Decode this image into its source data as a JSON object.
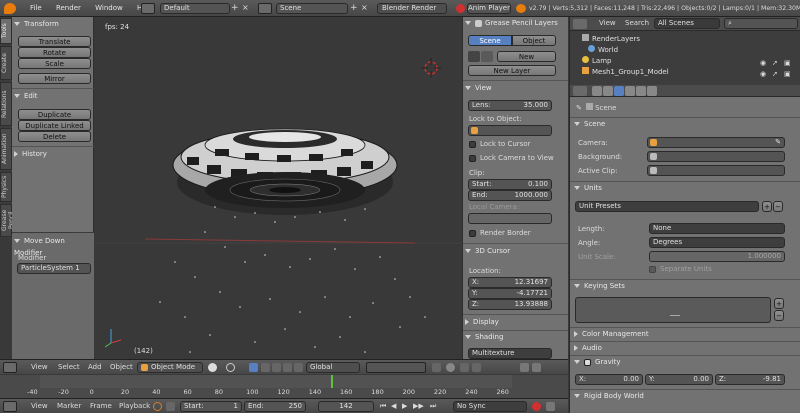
{
  "top_bar": {
    "menus": [
      "File",
      "Render",
      "Window",
      "Help"
    ],
    "screen_layout": "Default",
    "scene_name": "Scene",
    "render_engine": "Blender Render",
    "anim_player": "Anim Player",
    "stats": "v2.79 | Verts:5,312 | Faces:11,248 | Tris:22,496 | Objects:0/2 | Lamps:0/1 | Mem:32.30M"
  },
  "tool_tabs": [
    "Tools",
    "Create",
    "Relations",
    "Animation",
    "Physics",
    "Grease Pencil"
  ],
  "tool_shelf": {
    "transform_title": "Transform",
    "translate": "Translate",
    "rotate": "Rotate",
    "scale": "Scale",
    "mirror": "Mirror",
    "edit_title": "Edit",
    "duplicate": "Duplicate",
    "duplicate_linked": "Duplicate Linked",
    "delete": "Delete",
    "history_title": "History",
    "operator_title": "Move Down Modifier",
    "modifier_label": "Modifier",
    "modifier_value": "ParticleSystem 1"
  },
  "viewport": {
    "fps": "fps: 24",
    "frame": "(142)"
  },
  "n_panel": {
    "grease_pencil_title": "Grease Pencil Layers",
    "scene_btn": "Scene",
    "object_btn": "Object",
    "new_btn": "New",
    "new_layer_btn": "New Layer",
    "view_title": "View",
    "lens_label": "Lens:",
    "lens_value": "35.000",
    "lock_to_object": "Lock to Object:",
    "lock_to_cursor": "Lock to Cursor",
    "lock_camera_to_view": "Lock Camera to View",
    "clip_label": "Clip:",
    "clip_start_label": "Start:",
    "clip_start_value": "0.100",
    "clip_end_label": "End:",
    "clip_end_value": "1000.000",
    "local_camera": "Local Camera:",
    "render_border": "Render Border",
    "cursor_title": "3D Cursor",
    "location_label": "Location:",
    "x_label": "X:",
    "x_value": "12.31697",
    "y_label": "Y:",
    "y_value": "-4.17721",
    "z_label": "Z:",
    "z_value": "13.93888",
    "display_title": "Display",
    "shading_title": "Shading",
    "shading_value": "Multitexture"
  },
  "outliner": {
    "view": "View",
    "search": "Search",
    "filter": "All Scenes",
    "items": [
      "RenderLayers",
      "World",
      "Lamp",
      "Mesh1_Group1_Model"
    ]
  },
  "properties": {
    "breadcrumb": "Scene",
    "scene_title": "Scene",
    "camera_label": "Camera:",
    "background_label": "Background:",
    "active_clip_label": "Active Clip:",
    "units_title": "Units",
    "unit_presets": "Unit Presets",
    "length_label": "Length:",
    "length_value": "None",
    "angle_label": "Angle:",
    "angle_value": "Degrees",
    "unit_scale_label": "Unit Scale:",
    "unit_scale_value": "1.000000",
    "separate_units": "Separate Units",
    "keying_sets_title": "Keying Sets",
    "color_mgmt_title": "Color Management",
    "audio_title": "Audio",
    "gravity_title": "Gravity",
    "gx_label": "X:",
    "gx_value": "0.00",
    "gy_label": "Y:",
    "gy_value": "0.00",
    "gz_label": "Z:",
    "gz_value": "-9.81",
    "rigid_body_title": "Rigid Body World"
  },
  "view_header": {
    "menus": [
      "View",
      "Select",
      "Add",
      "Object"
    ],
    "mode": "Object Mode",
    "orientation": "Global"
  },
  "timeline": {
    "ticks": [
      "-40",
      "-20",
      "0",
      "20",
      "40",
      "60",
      "80",
      "100",
      "120",
      "140",
      "160",
      "180",
      "200",
      "220",
      "240",
      "260"
    ],
    "current_frame_marker": 142
  },
  "timeline_header": {
    "menus": [
      "View",
      "Marker",
      "Frame",
      "Playback"
    ],
    "start_label": "Start:",
    "start_value": "1",
    "end_label": "End:",
    "end_value": "250",
    "current": "142",
    "sync": "No Sync"
  },
  "colors": {
    "accent_blue": "#5680c2",
    "viewport_bg": "#393939",
    "panel_bg": "#727272",
    "frame_green": "#60c040"
  }
}
